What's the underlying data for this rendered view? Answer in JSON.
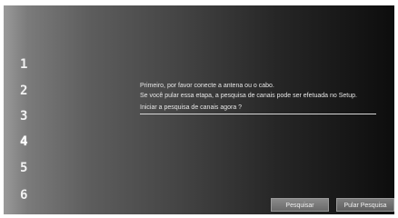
{
  "steps": {
    "items": [
      "1",
      "2",
      "3",
      "4",
      "5",
      "6"
    ],
    "active_index": 3
  },
  "message": {
    "line1": "Primeiro, por favor conecte a antena ou o cabo.",
    "line2": "Se você pular essa etapa, a pesquisa de canais pode ser efetuada no Setup.",
    "prompt": "Iniciar a pesquisa de canais agora ?"
  },
  "buttons": {
    "search_label": "Pesquisar",
    "skip_label": "Pular Pesquisa"
  }
}
